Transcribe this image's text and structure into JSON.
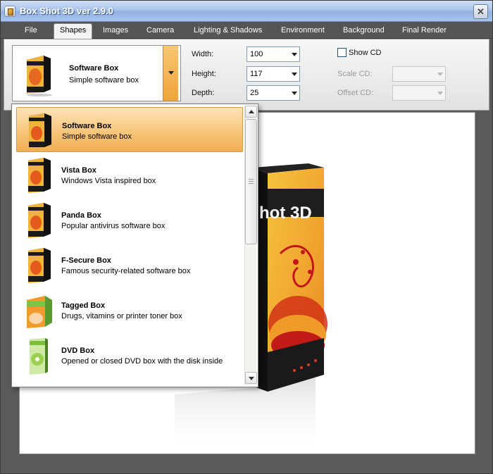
{
  "window": {
    "title": "Box Shot 3D ver 2.9.0",
    "close_glyph": "✕"
  },
  "menu": {
    "tabs": [
      {
        "label": "File"
      },
      {
        "label": "Shapes",
        "active": true
      },
      {
        "label": "Images"
      },
      {
        "label": "Camera"
      },
      {
        "label": "Lighting & Shadows"
      },
      {
        "label": "Environment"
      },
      {
        "label": "Background"
      },
      {
        "label": "Final Render"
      }
    ]
  },
  "shape_selector": {
    "selected_title": "Software Box",
    "selected_subtitle": "Simple software box"
  },
  "dimensions": {
    "width_label": "Width:",
    "width_value": "100",
    "height_label": "Height:",
    "height_value": "117",
    "depth_label": "Depth:",
    "depth_value": "25"
  },
  "cd_options": {
    "show_cd_label": "Show CD",
    "show_cd_checked": false,
    "scale_cd_label": "Scale CD:",
    "offset_cd_label": "Offset CD:"
  },
  "shape_list": {
    "items": [
      {
        "title": "Software Box",
        "desc": "Simple software box",
        "style": "software",
        "selected": true
      },
      {
        "title": "Vista Box",
        "desc": "Windows Vista inspired box",
        "style": "software"
      },
      {
        "title": "Panda Box",
        "desc": "Popular antivirus software box",
        "style": "software"
      },
      {
        "title": "F-Secure Box",
        "desc": "Famous security-related software box",
        "style": "software"
      },
      {
        "title": "Tagged Box",
        "desc": "Drugs, vitamins or printer toner box",
        "style": "tagged"
      },
      {
        "title": "DVD Box",
        "desc": "Opened or closed DVD box with the disk inside",
        "style": "dvd"
      }
    ]
  },
  "preview": {
    "box_text": "hot 3D"
  },
  "colors": {
    "accent": "#f2ae52",
    "tab_bar": "#555555",
    "title_bar": "#a9c3ea"
  }
}
